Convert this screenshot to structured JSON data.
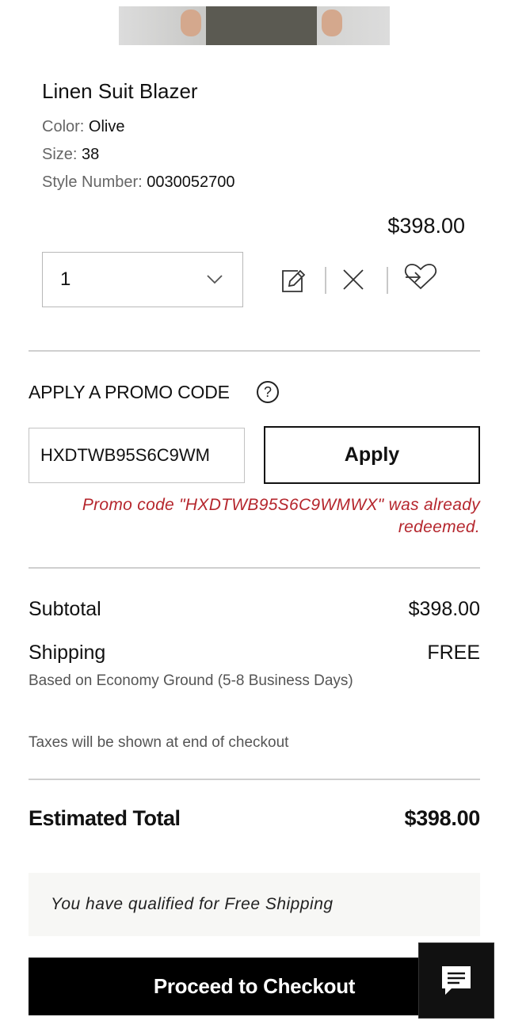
{
  "product": {
    "name": "Linen Suit Blazer",
    "color_label": "Color:",
    "color_value": "Olive",
    "size_label": "Size:",
    "size_value": "38",
    "style_label": "Style Number:",
    "style_value": "0030052700",
    "price": "$398.00",
    "quantity": "1"
  },
  "icons": {
    "edit": "edit-icon",
    "remove": "close-icon",
    "wishlist": "move-to-wishlist-icon",
    "dropdown": "chevron-down-icon",
    "help": "help-icon",
    "chat": "chat-icon"
  },
  "promo": {
    "title": "APPLY A PROMO CODE",
    "help_symbol": "?",
    "input_value": "HXDTWB95S6C9WM",
    "apply_label": "Apply",
    "error_message": "Promo code \"HXDTWB95S6C9WMWX\" was already redeemed."
  },
  "summary": {
    "subtotal_label": "Subtotal",
    "subtotal_value": "$398.00",
    "shipping_label": "Shipping",
    "shipping_value": "FREE",
    "shipping_note": "Based on Economy Ground (5-8 Business Days)",
    "tax_note": "Taxes will be shown at end of checkout",
    "total_label": "Estimated Total",
    "total_value": "$398.00"
  },
  "banner": {
    "free_shipping": "You have qualified for Free Shipping"
  },
  "checkout": {
    "label": "Proceed to Checkout"
  },
  "colors": {
    "error": "#b5262d",
    "button_dark": "#000000",
    "banner_bg": "#f7f7f5"
  }
}
